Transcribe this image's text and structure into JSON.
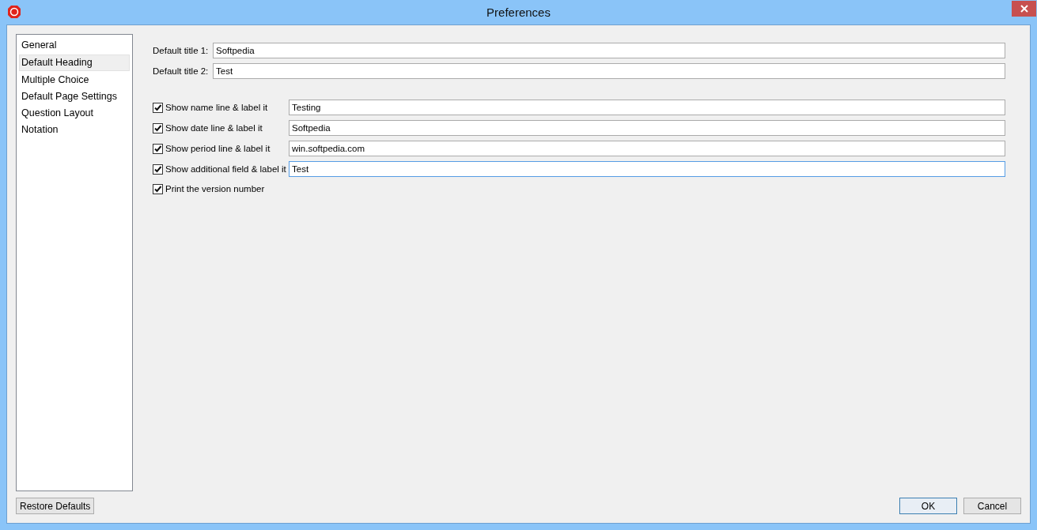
{
  "window": {
    "title": "Preferences"
  },
  "sidebar": {
    "items": [
      {
        "label": "General",
        "selected": false
      },
      {
        "label": "Default Heading",
        "selected": true
      },
      {
        "label": "Multiple Choice",
        "selected": false
      },
      {
        "label": "Default Page Settings",
        "selected": false
      },
      {
        "label": "Question Layout",
        "selected": false
      },
      {
        "label": "Notation",
        "selected": false
      }
    ]
  },
  "titles": [
    {
      "label": "Default title 1:",
      "value": "Softpedia"
    },
    {
      "label": "Default title 2:",
      "value": "Test"
    }
  ],
  "options": [
    {
      "kind": "field",
      "label": "Show name line & label it",
      "checked": true,
      "value": "Testing",
      "focused": false
    },
    {
      "kind": "field",
      "label": "Show date line & label it",
      "checked": true,
      "value": "Softpedia",
      "focused": false
    },
    {
      "kind": "field",
      "label": "Show period line & label it",
      "checked": true,
      "value": "win.softpedia.com",
      "focused": false
    },
    {
      "kind": "field",
      "label": "Show additional field & label it",
      "checked": true,
      "value": "Test",
      "focused": true
    },
    {
      "kind": "plain",
      "label": "Print the version number",
      "checked": true
    }
  ],
  "buttons": {
    "restore": "Restore Defaults",
    "ok": "OK",
    "cancel": "Cancel"
  }
}
